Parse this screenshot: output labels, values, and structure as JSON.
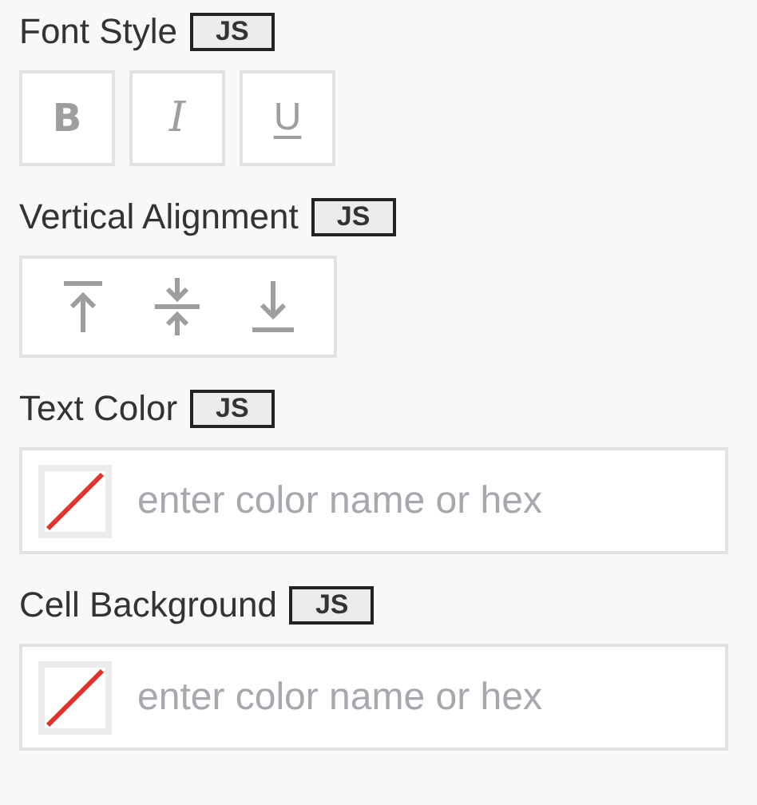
{
  "sections": [
    {
      "kind": "font_style",
      "label": "Font Style",
      "badge": "JS",
      "buttons": [
        {
          "kind": "bold",
          "glyph": "B"
        },
        {
          "kind": "italic",
          "glyph": "I"
        },
        {
          "kind": "underline",
          "glyph": "U"
        }
      ]
    },
    {
      "kind": "vertical_alignment",
      "label": "Vertical Alignment",
      "badge": "JS",
      "options": [
        {
          "kind": "top"
        },
        {
          "kind": "middle"
        },
        {
          "kind": "bottom"
        }
      ]
    },
    {
      "kind": "color",
      "label": "Text Color",
      "badge": "JS",
      "placeholder": "enter color name or hex"
    },
    {
      "kind": "color",
      "label": "Cell Background",
      "badge": "JS",
      "placeholder": "enter color name or hex"
    }
  ]
}
